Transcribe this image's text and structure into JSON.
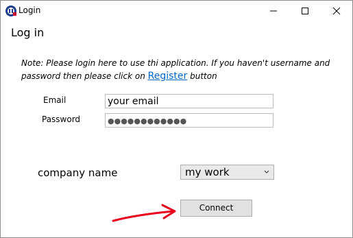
{
  "window": {
    "title": "Login"
  },
  "titlebar_buttons": {
    "minimize": "minimize-icon",
    "maximize": "maximize-icon",
    "close": "close-icon"
  },
  "page": {
    "heading": "Log in",
    "note_before": "Note: Please login here to use thi application. If you haven't username and password then please click on ",
    "register_link": "Register",
    "note_after": " button"
  },
  "form": {
    "email_label": "Email",
    "email_value": "your email",
    "password_label": "Password",
    "password_value": "●●●●●●●●●●●●",
    "company_label": "company name",
    "company_selected": "my work",
    "connect_label": "Connect"
  },
  "colors": {
    "link": "#0066cc",
    "annotation_arrow": "#e8001c"
  }
}
